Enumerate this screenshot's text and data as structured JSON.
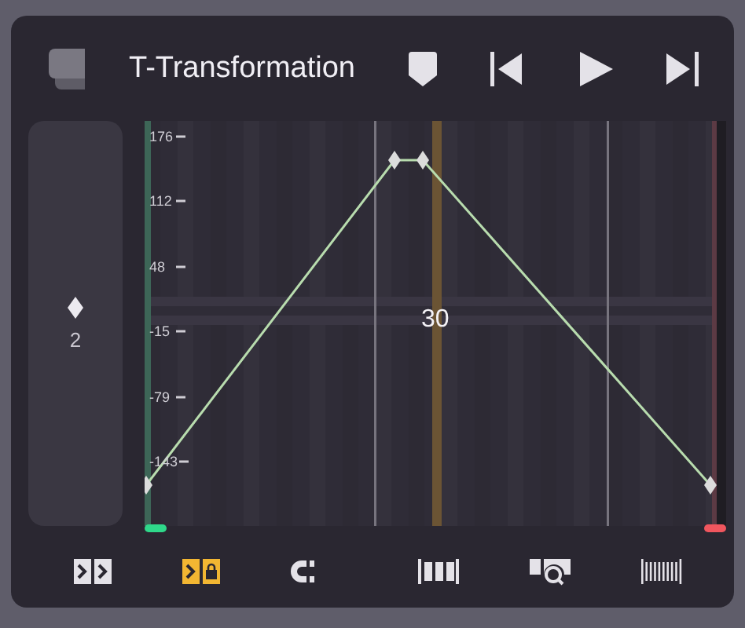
{
  "header": {
    "title": "T-Transformation"
  },
  "track": {
    "keyframe_count": "2"
  },
  "graph": {
    "y_ticks": [
      "176",
      "112",
      "48",
      "-15",
      "-79",
      "-143"
    ],
    "frame_label": "30"
  },
  "toolbar": [
    {
      "kind": "step",
      "selected": false
    },
    {
      "kind": "step-lock",
      "selected": true
    },
    {
      "kind": "magnet",
      "selected": false
    },
    {
      "kind": "divider"
    },
    {
      "kind": "frames",
      "selected": false
    },
    {
      "kind": "zoom",
      "selected": false
    },
    {
      "kind": "lines",
      "selected": false
    }
  ]
}
